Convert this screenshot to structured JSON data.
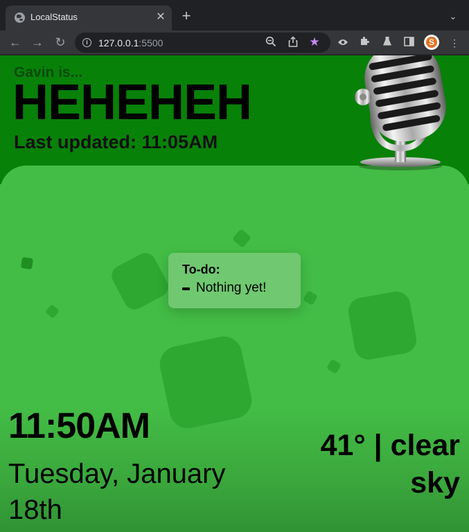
{
  "browser": {
    "tab_title": "LocalStatus",
    "url_host": "127.0.0.1",
    "url_port": ":5500",
    "icons": {
      "tab_favicon": "globe-icon",
      "tab_close": "close-icon",
      "new_tab": "plus-icon",
      "tab_search": "chevron-down-icon",
      "back": "arrow-left-icon",
      "forward": "arrow-right-icon",
      "reload": "reload-icon",
      "site_info": "info-icon",
      "zoom": "zoom-out-icon",
      "share": "share-icon",
      "bookmark": "star-icon",
      "ext_eye": "eye-icon",
      "extensions": "puzzle-icon",
      "labs": "flask-icon",
      "side_panel": "side-panel-icon",
      "profile": "profile-avatar",
      "menu": "kebab-menu-icon"
    },
    "profile_letter": "S",
    "bookmark_color": "#c58af9"
  },
  "status": {
    "prefix": "Gavin is...",
    "value": "HEHEHEH",
    "last_updated": "Last updated: 11:05AM",
    "icon": "microphone-icon"
  },
  "todo": {
    "title": "To-do:",
    "items": [
      "Nothing yet!"
    ]
  },
  "clock": {
    "time": "11:50AM",
    "date": "Tuesday, January 18th"
  },
  "weather": {
    "summary": "41° | clear sky"
  },
  "colors": {
    "header_bg": "#088108",
    "body_bg": "#43bd45",
    "card_bg": "#70c870",
    "square": "#2ea831"
  }
}
